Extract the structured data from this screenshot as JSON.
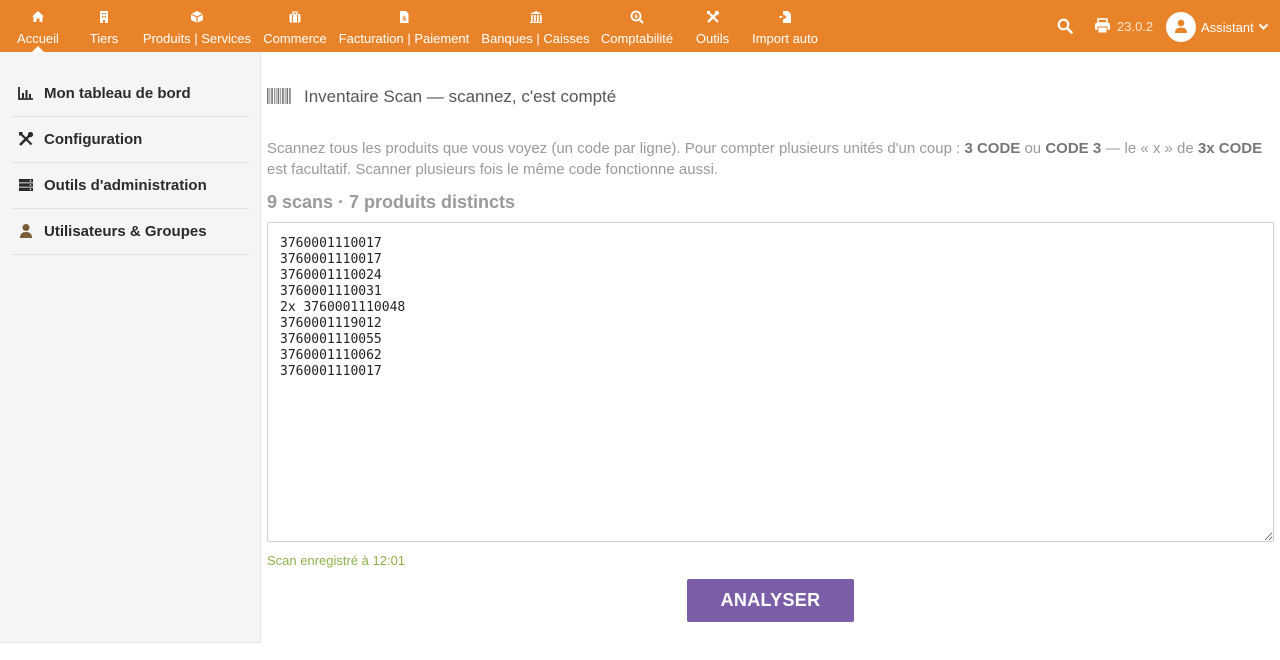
{
  "topbar": {
    "menu": [
      {
        "label": "Accueil",
        "icon": "home-icon"
      },
      {
        "label": "Tiers",
        "icon": "building-icon"
      },
      {
        "label": "Produits | Services",
        "icon": "cube-icon"
      },
      {
        "label": "Commerce",
        "icon": "briefcase-icon"
      },
      {
        "label": "Facturation | Paiement",
        "icon": "invoice-icon"
      },
      {
        "label": "Banques | Caisses",
        "icon": "bank-icon"
      },
      {
        "label": "Comptabilité",
        "icon": "search-dollar-icon"
      },
      {
        "label": "Outils",
        "icon": "tools-icon"
      },
      {
        "label": "Import auto",
        "icon": "file-import-icon"
      }
    ],
    "version": "23.0.2",
    "user": "Assistant",
    "accent": "#e8832a"
  },
  "sidebar": {
    "items": [
      {
        "label": "Mon tableau de bord",
        "icon": "chart-bar-icon"
      },
      {
        "label": "Configuration",
        "icon": "tools-icon"
      },
      {
        "label": "Outils d'administration",
        "icon": "server-icon"
      },
      {
        "label": "Utilisateurs & Groupes",
        "icon": "user-icon"
      }
    ]
  },
  "main": {
    "title": "Inventaire Scan — scannez, c'est compté",
    "desc": {
      "part1": "Scannez tous les produits que vous voyez (un code par ligne). Pour compter plusieurs unités d'un coup : ",
      "b1": "3 CODE",
      "part2": " ou ",
      "b2": "CODE 3",
      "part3": " — le « x » de ",
      "b3": "3x CODE",
      "part4": " est facultatif. Scanner plusieurs fois le même code fonctionne aussi."
    },
    "stats": "9 scans · 7 produits distincts",
    "scan_text": "3760001110017\n3760001110017\n3760001110024\n3760001110031\n2x 3760001110048\n3760001119012\n3760001110055\n3760001110062\n3760001110017",
    "saved_status": "Scan enregistré à 12:01",
    "analyze_label": "ANALYSER",
    "button_color": "#7b5ea7"
  }
}
